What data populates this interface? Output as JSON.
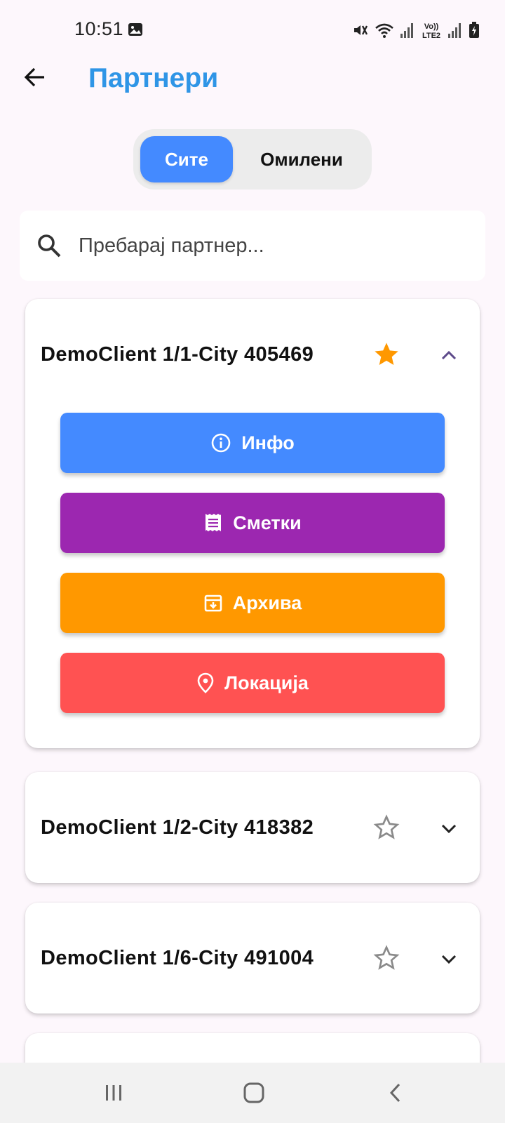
{
  "status_bar": {
    "time": "10:51",
    "icons": [
      "image-icon",
      "mute-icon",
      "wifi-icon",
      "signal-icon",
      "volte-icon",
      "signal-icon",
      "battery-icon"
    ],
    "volte_label_top": "Vo))",
    "volte_label_bottom": "LTE2"
  },
  "header": {
    "title": "Партнери",
    "back_icon": "arrow-back-icon"
  },
  "tabs": {
    "all_label": "Сите",
    "favorites_label": "Омилени",
    "selected": "all"
  },
  "search": {
    "placeholder": "Пребарај партнер...",
    "value": "",
    "icon": "search-icon"
  },
  "partners": [
    {
      "name": "DemoClient 1/1-City 405469",
      "favorite": true,
      "expanded": true,
      "actions": {
        "info_label": "Инфо",
        "bills_label": "Сметки",
        "archive_label": "Архива",
        "location_label": "Локација"
      }
    },
    {
      "name": "DemoClient 1/2-City 418382",
      "favorite": false,
      "expanded": false
    },
    {
      "name": "DemoClient 1/6-City 491004",
      "favorite": false,
      "expanded": false
    }
  ],
  "colors": {
    "title": "#2f95e6",
    "accent": "#448aff",
    "info": "#448aff",
    "bills": "#9c27b0",
    "archive": "#ff9800",
    "location": "#ff5252",
    "star_active": "#ff9800",
    "chevron_up": "#5e4b8b"
  },
  "nav_bar": {
    "icons": [
      "recent-apps-icon",
      "home-icon",
      "back-icon"
    ]
  }
}
